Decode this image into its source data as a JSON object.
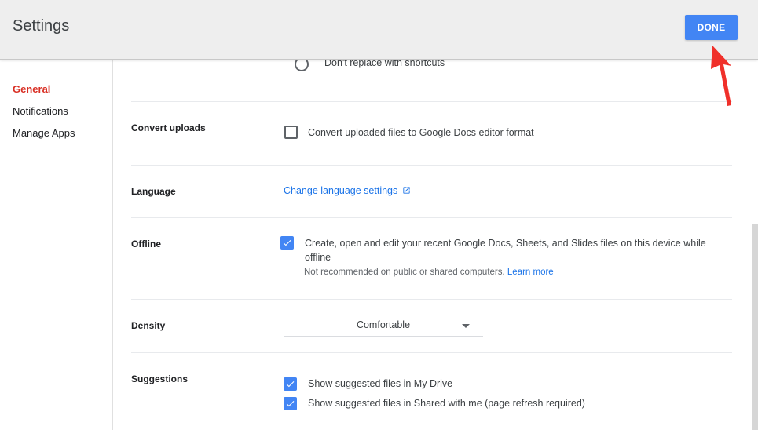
{
  "header": {
    "title": "Settings",
    "done_label": "DONE"
  },
  "sidebar": {
    "items": [
      {
        "label": "General",
        "active": true
      },
      {
        "label": "Notifications",
        "active": false
      },
      {
        "label": "Manage Apps",
        "active": false
      }
    ]
  },
  "sections": {
    "shortcuts": {
      "option": "Don't replace with shortcuts",
      "checked": false
    },
    "convert": {
      "label": "Convert uploads",
      "option": "Convert uploaded files to Google Docs editor format",
      "checked": false
    },
    "language": {
      "label": "Language",
      "link": "Change language settings"
    },
    "offline": {
      "label": "Offline",
      "option_line1": "Create, open and edit your recent Google Docs, Sheets, and Slides files on this device while",
      "option_line2": "offline",
      "note": "Not recommended on public or shared computers.",
      "learn_more": "Learn more",
      "checked": true
    },
    "density": {
      "label": "Density",
      "value": "Comfortable"
    },
    "suggestions": {
      "label": "Suggestions",
      "options": [
        {
          "text": "Show suggested files in My Drive",
          "checked": true
        },
        {
          "text": "Show suggested files in Shared with me (page refresh required)",
          "checked": true
        }
      ]
    }
  },
  "colors": {
    "accent": "#4285f4",
    "active_nav": "#d93025",
    "link": "#1a73e8",
    "annotation_arrow": "#f0302a"
  },
  "icons": [
    "external-link-icon",
    "checkmark-icon",
    "dropdown-arrow-icon",
    "annotation-arrow-icon"
  ]
}
